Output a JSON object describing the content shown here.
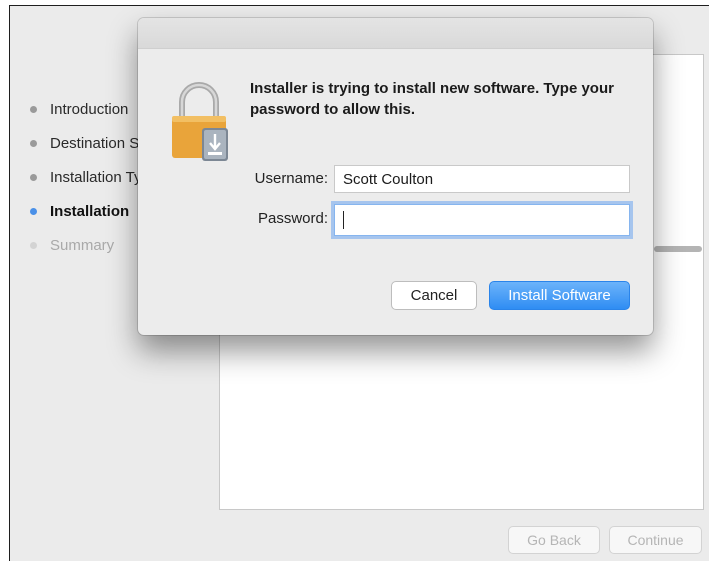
{
  "sidebar": {
    "steps": [
      {
        "label": "Introduction",
        "state": "done"
      },
      {
        "label": "Destination Select",
        "state": "done"
      },
      {
        "label": "Installation Type",
        "state": "done"
      },
      {
        "label": "Installation",
        "state": "active"
      },
      {
        "label": "Summary",
        "state": "future"
      }
    ]
  },
  "footer": {
    "go_back_label": "Go Back",
    "continue_label": "Continue"
  },
  "dialog": {
    "message": "Installer is trying to install new software. Type your password to allow this.",
    "username_label": "Username:",
    "username_value": "Scott Coulton",
    "password_label": "Password:",
    "password_value": "",
    "cancel_label": "Cancel",
    "install_label": "Install Software",
    "icon": "lock-icon"
  },
  "colors": {
    "accent": "#2f8df3",
    "active_step_dot": "#4a90e8",
    "lock_body": "#e9a43a"
  }
}
